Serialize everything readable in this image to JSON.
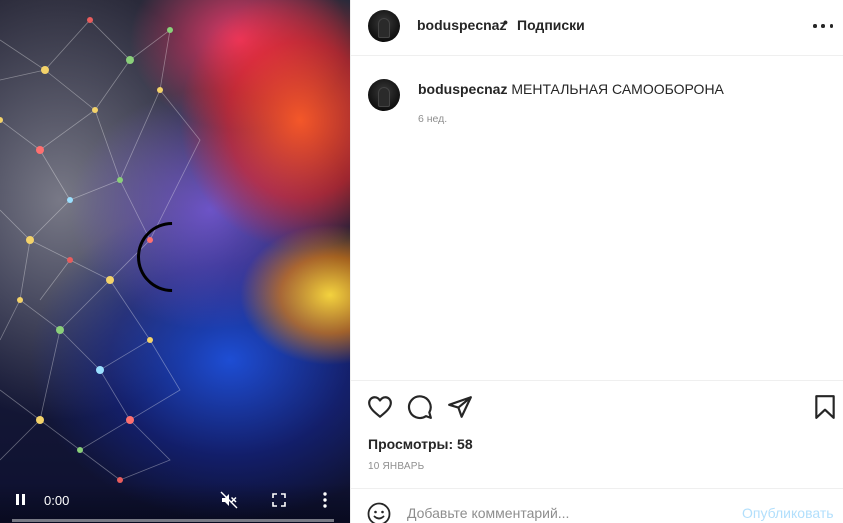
{
  "video": {
    "time": "0:00",
    "progress": 0.0,
    "icons": [
      "pause-icon",
      "mute-icon",
      "fullscreen-icon",
      "more-vertical-icon",
      "loading-spinner"
    ]
  },
  "header": {
    "username": "boduspecnaz",
    "separator": "•",
    "follow_label": "Подписки",
    "more_icon": "more-horizontal-icon"
  },
  "caption": {
    "username": "boduspecnaz",
    "text": "МЕНТАЛЬНАЯ САМООБОРОНА",
    "time_ago": "6 нед."
  },
  "actions": {
    "icons": [
      "heart-icon",
      "comment-icon",
      "share-icon",
      "bookmark-icon"
    ],
    "views": "Просмотры: 58",
    "date": "10 ЯНВАРЬ"
  },
  "comment": {
    "placeholder": "Добавьте комментарий...",
    "post_label": "Опубликовать",
    "post_color": "#b2dffc",
    "emoji_icon": "emoji-icon"
  }
}
